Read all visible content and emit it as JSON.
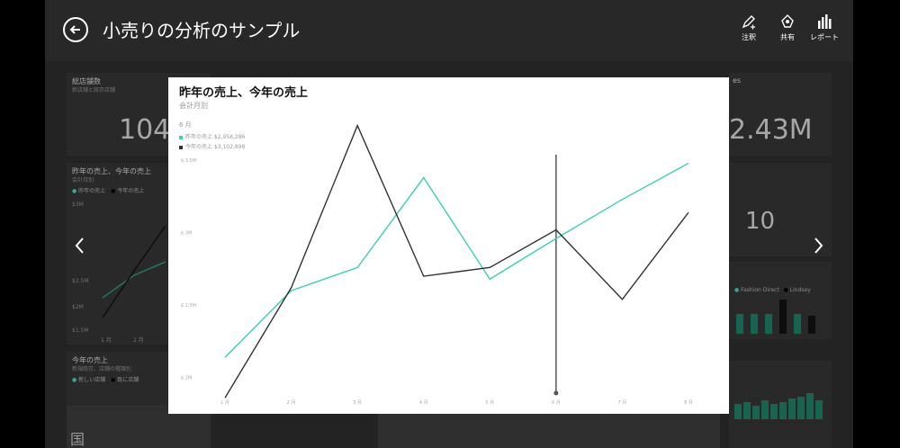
{
  "header": {
    "title": "小売りの分析のサンプル",
    "actions": [
      {
        "label": "注釈",
        "icon": "pen-icon"
      },
      {
        "label": "共有",
        "icon": "share-icon"
      },
      {
        "label": "レポート",
        "icon": "bar-chart-icon"
      }
    ]
  },
  "background_tiles": {
    "tile1": {
      "title": "総店舗数",
      "subtitle": "新店舗と既存店舗",
      "value": "104"
    },
    "tile_right": {
      "value": "2.43M",
      "title": "es"
    },
    "tile_count": {
      "value": "10"
    },
    "tile_chart": {
      "title": "昨年の売上、今年の売上",
      "subtitle": "会計月別",
      "legend": [
        "昨年の売上",
        "今年の売上"
      ],
      "yticks": [
        "$3M",
        "$2.5M",
        "$2M",
        "$1.5M"
      ],
      "xticks": [
        "1 月",
        "2 月"
      ]
    },
    "tile_sales": {
      "title": "今年の売上",
      "subtitle": "新規既存、店舗の種類別",
      "legend": [
        "新しい店舗",
        "既に店舗"
      ]
    },
    "tile_store": {
      "legend": [
        "Fashion Direct",
        "Lindsey"
      ]
    },
    "map_text": "国"
  },
  "modal": {
    "title": "昨年の売上、今年の売上",
    "subtitle": "会計月別",
    "month_label": "6 月",
    "legend": [
      {
        "label": "昨年の売上 $2,958,286",
        "color": "#3ecfb2"
      },
      {
        "label": "今年の売上 $3,102,898",
        "color": "#333333"
      }
    ]
  },
  "chart_data": {
    "type": "line",
    "title": "昨年の売上、今年の売上",
    "subtitle": "会計月別",
    "categories": [
      "1 月",
      "2 月",
      "3 月",
      "4 月",
      "5 月",
      "6 月",
      "7 月",
      "8 月"
    ],
    "yticks": [
      {
        "label": "$ 3.5M",
        "value": 3.5
      },
      {
        "label": "$ 3M",
        "value": 3.0
      },
      {
        "label": "$ 2.5M",
        "value": 2.5
      },
      {
        "label": "$ 2M",
        "value": 2.0
      }
    ],
    "ylim": [
      1.75,
      3.7
    ],
    "series": [
      {
        "name": "昨年の売上",
        "color": "#3ecfb2",
        "values": [
          2.14,
          2.6,
          2.76,
          3.38,
          2.68,
          2.96,
          3.23,
          3.48
        ]
      },
      {
        "name": "今年の売上",
        "color": "#333333",
        "values": [
          1.86,
          2.62,
          3.74,
          2.7,
          2.76,
          3.02,
          2.54,
          3.14
        ]
      }
    ],
    "highlight_category": "6 月",
    "grid": false,
    "legend_position": "top-left"
  }
}
